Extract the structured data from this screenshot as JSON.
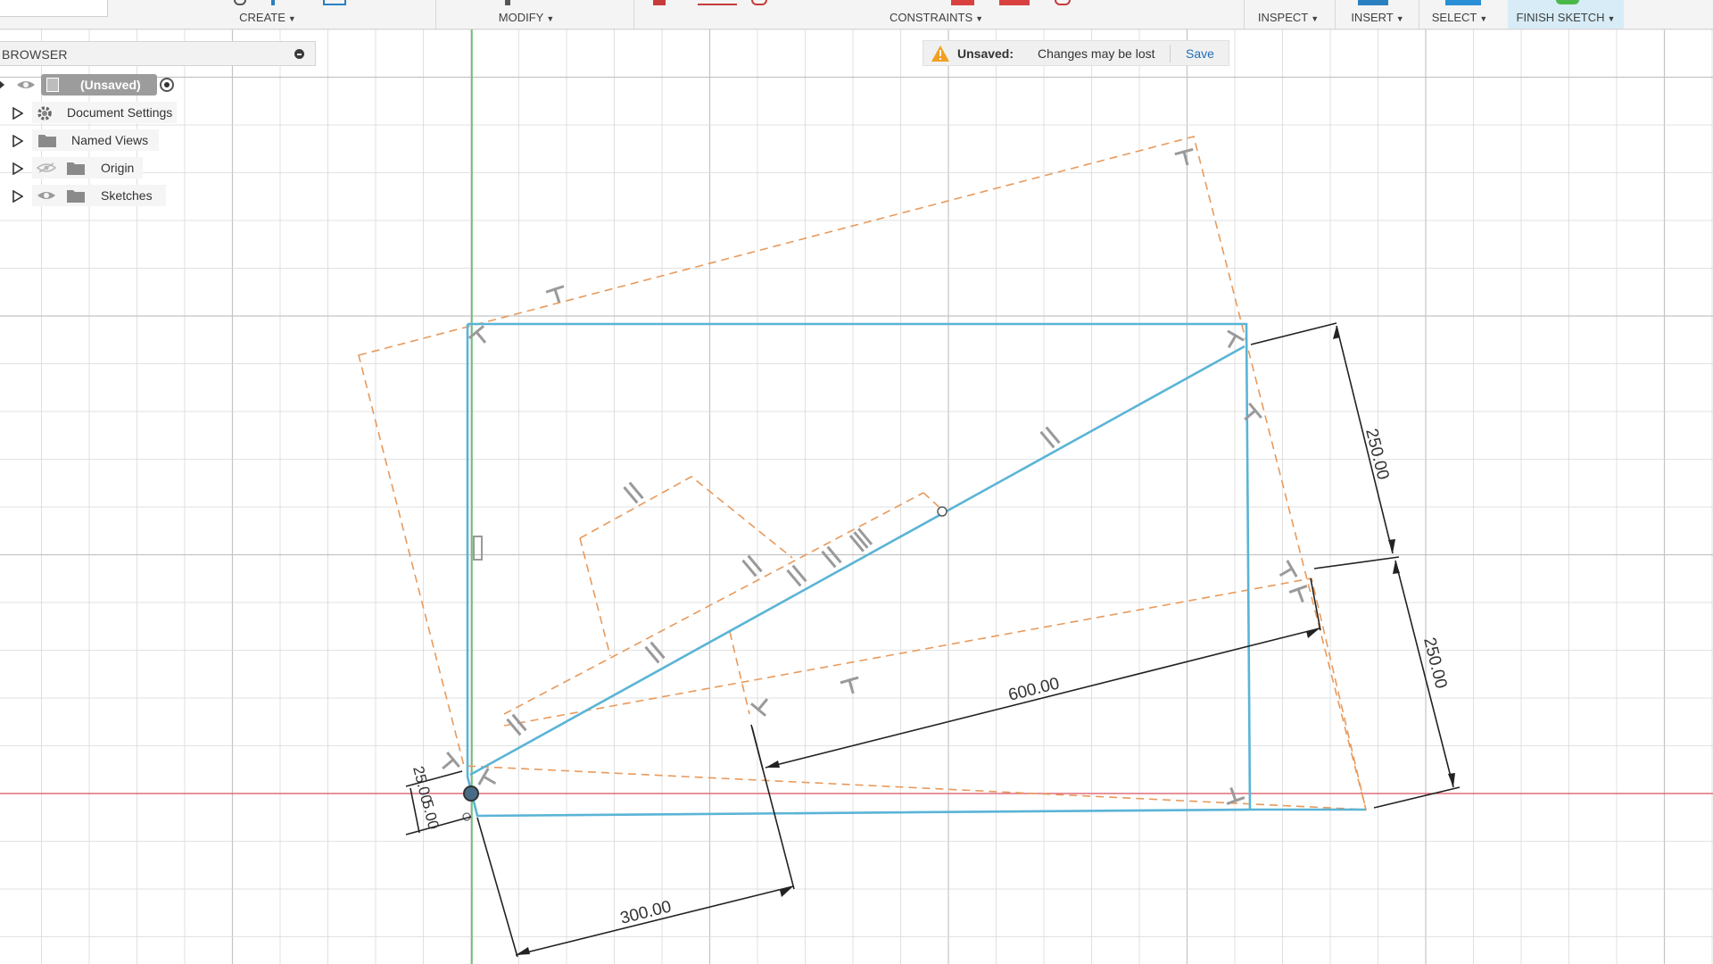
{
  "toolbar": {
    "groups": [
      {
        "label": "CREATE"
      },
      {
        "label": "MODIFY"
      },
      {
        "label": "CONSTRAINTS"
      },
      {
        "label": "INSPECT"
      },
      {
        "label": "INSERT"
      },
      {
        "label": "SELECT"
      },
      {
        "label": "FINISH SKETCH"
      }
    ]
  },
  "browser": {
    "title": "BROWSER",
    "root": "(Unsaved)",
    "items": [
      {
        "label": "Document Settings",
        "icon": "gear-icon"
      },
      {
        "label": "Named Views",
        "icon": "folder-icon"
      },
      {
        "label": "Origin",
        "icon": "folder-icon",
        "visibility": "hidden"
      },
      {
        "label": "Sketches",
        "icon": "folder-icon",
        "visibility": "visible"
      }
    ]
  },
  "notification": {
    "title": "Unsaved:",
    "message": "Changes may be lost",
    "action": "Save"
  },
  "sketch": {
    "dimensions": [
      {
        "label": "250.00"
      },
      {
        "label": "250.00"
      },
      {
        "label": "600.00"
      },
      {
        "label": "300.00"
      },
      {
        "label": "25.00"
      },
      {
        "label": "5.00"
      }
    ]
  },
  "colors": {
    "sketch_line": "#5ab4d6",
    "construction_line": "#e89a5c",
    "grid": "#d9d9d9",
    "x_axis": "#e05a6a",
    "y_axis": "#3cb54a",
    "dimension": "#222222",
    "constraint_glyph": "#9a9a9a",
    "finish_sketch_bg": "#d7ecf6"
  }
}
